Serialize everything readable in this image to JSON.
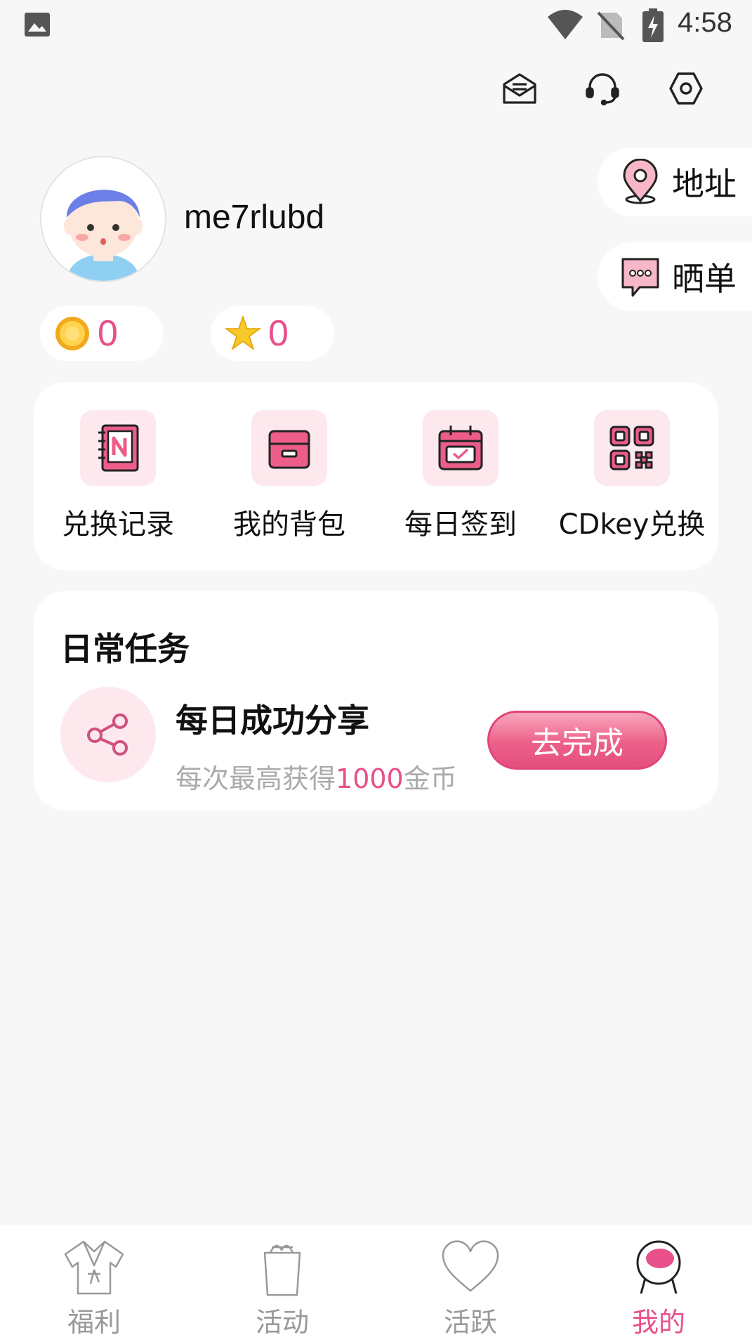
{
  "status_bar": {
    "time": "4:58"
  },
  "header_icons": [
    "mail-icon",
    "headset-icon",
    "settings-icon"
  ],
  "side_buttons": {
    "address_label": "地址",
    "share_order_label": "晒单"
  },
  "profile": {
    "username": "me7rlubd",
    "coins": "0",
    "stars": "0"
  },
  "quick_actions": [
    {
      "label": "兑换记录",
      "icon": "notebook-icon"
    },
    {
      "label": "我的背包",
      "icon": "box-icon"
    },
    {
      "label": "每日签到",
      "icon": "calendar-check-icon"
    },
    {
      "label": "CDkey兑换",
      "icon": "qr-code-icon"
    }
  ],
  "daily_tasks": {
    "title": "日常任务",
    "items": [
      {
        "name": "每日成功分享",
        "desc_prefix": "每次最高获得",
        "desc_amount": "1000",
        "desc_suffix": "金币",
        "button_label": "去完成"
      }
    ]
  },
  "tab_bar": {
    "items": [
      {
        "label": "福利",
        "active": false
      },
      {
        "label": "活动",
        "active": false
      },
      {
        "label": "活跃",
        "active": false
      },
      {
        "label": "我的",
        "active": true
      }
    ]
  },
  "colors": {
    "accent": "#e8508a",
    "icon_bg": "#fde8ee",
    "page_bg": "#f7f7f8"
  }
}
